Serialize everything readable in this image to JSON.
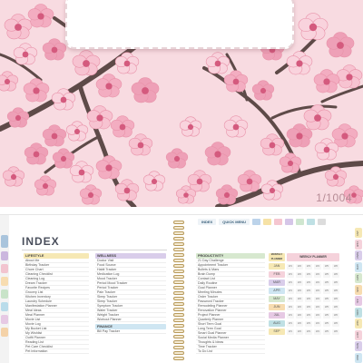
{
  "cover": {
    "page_counter": "1/1004",
    "background_color": "#f8dbe1",
    "accent_color": "#f1a7bd"
  },
  "nav": {
    "index_label": "INDEX",
    "quick_menu_label": "QUICK MENU"
  },
  "index": {
    "title": "INDEX",
    "lifestyle": {
      "heading": "LIFESTYLE",
      "items": [
        "About Me",
        "Birthday Tracker",
        "Chore Chart",
        "Cleaning Checklist",
        "Cleaning Log",
        "Dream Tracker",
        "Favorite Recipes",
        "Grocery List",
        "Kitchen Inventory",
        "Laundry Schedule",
        "Manifestation Planner",
        "Meal Ideas",
        "Meal Planner",
        "Movie List",
        "Movie Log",
        "My Bucket List",
        "My Wishlist",
        "Outfit Planner",
        "Reading List",
        "Pet Care Checklist",
        "Pet Information"
      ]
    },
    "wellness": {
      "heading": "WELLNESS",
      "items": [
        "Doctor Visit",
        "Food Source",
        "Habit Tracker",
        "Medication Log",
        "Mood Tracker",
        "Period Mood Tracker",
        "Period Tracker",
        "Pain Tracker",
        "Sleep Tracker",
        "Sleep Tracker",
        "Symptom Tracker",
        "Water Tracker",
        "Weight Tracker",
        "Workout Planner"
      ],
      "second_heading": "FINANCE",
      "second_items": [
        "Bill Pay Tracker"
      ]
    },
    "productivity": {
      "heading": "PRODUCTIVITY",
      "items": [
        "21 Day Challenge",
        "Appointment Tracker",
        "Bullets & Mars",
        "Brain Dump",
        "Contact List",
        "Daily Routine",
        "Goal Planner",
        "Meeting Minutes",
        "Order Tracker",
        "Password Tracker",
        "Remodeling Planner",
        "Renovation Planner",
        "Project Planner",
        "Quarterly Planner",
        "Short Term Goal",
        "Long Term Goal",
        "Smart Goal Planner",
        "Social Media Planner",
        "Thoughts & Ideas",
        "Time Tracker",
        "To Do List"
      ]
    },
    "monthly": {
      "heading_monthly": "MONTHLY PLANNER",
      "heading_weekly": "WEEKLY PLANNER",
      "months": [
        "JAN",
        "FEB",
        "MAR",
        "APR",
        "MAY",
        "JUN",
        "JUL",
        "AUG",
        "SEP"
      ],
      "weeks": [
        "W1",
        "W2",
        "W3",
        "W4",
        "W5",
        "W6"
      ]
    }
  },
  "tabs": {
    "left": [
      "Day",
      "",
      "",
      "",
      "",
      "",
      "",
      ""
    ],
    "right": [
      "JAN",
      "FEB",
      "MAR",
      "APR",
      "MAY",
      "JUN",
      "JUL",
      "AUG",
      "SEP",
      "OCT",
      "NOV",
      "DEC"
    ]
  }
}
